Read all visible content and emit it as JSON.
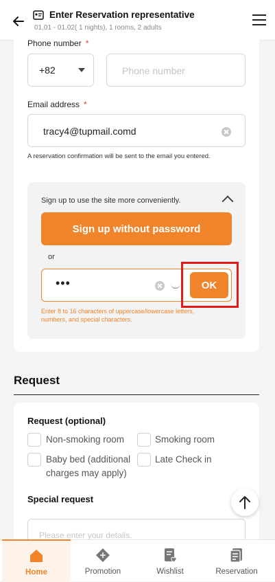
{
  "header": {
    "title": "Enter Reservation representative",
    "subtitle": "01.01 - 01.02( 1 nights), 1 rooms, 2 adults"
  },
  "contact": {
    "phone_label": "Phone number",
    "required_mark": "*",
    "country_code": "+82",
    "phone_placeholder": "Phone number",
    "email_label": "Email address",
    "email_value": "tracy4@tupmail.comd",
    "email_note": "A reservation confirmation will be sent to the email you entered."
  },
  "signup": {
    "prompt": "Sign up to use the site more conveniently.",
    "button_label": "Sign up without password",
    "or_text": "or",
    "password_mask": "•••",
    "ok_label": "OK",
    "password_hint": "Enter 8 to 16 characters of uppercase/lowercase letters, numbers, and special characters."
  },
  "request": {
    "title": "Request",
    "optional_title": "Request (optional)",
    "options": [
      "Non-smoking room",
      "Smoking room",
      "Baby bed (additional charges may apply)",
      "Late Check in"
    ],
    "special_title": "Special request",
    "special_placeholder": "Please enter your details."
  },
  "tabs": [
    {
      "label": "Home",
      "icon": "home-icon",
      "active": true
    },
    {
      "label": "Promotion",
      "icon": "promotion-icon",
      "active": false
    },
    {
      "label": "Wishlist",
      "icon": "wishlist-icon",
      "active": false
    },
    {
      "label": "Reservation",
      "icon": "reservation-icon",
      "active": false
    }
  ],
  "colors": {
    "accent": "#f0842a",
    "highlight": "#e11a1a"
  }
}
